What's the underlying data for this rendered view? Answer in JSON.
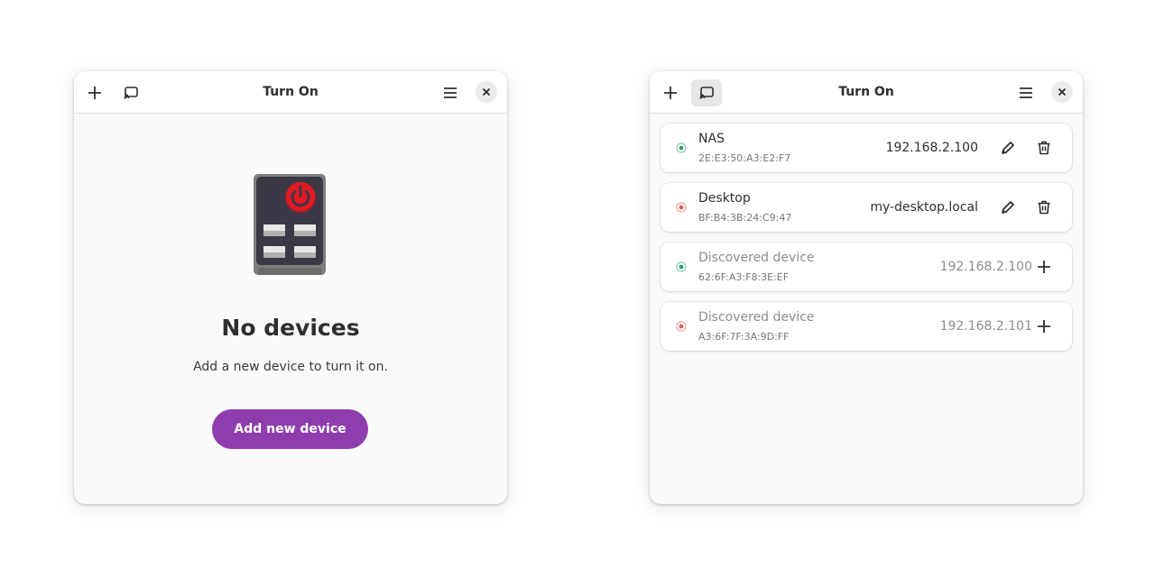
{
  "left_window": {
    "title": "Turn On",
    "empty_state": {
      "title": "No devices",
      "description": "Add a new device to turn it on.",
      "button_label": "Add new device"
    }
  },
  "right_window": {
    "title": "Turn On",
    "devices": [
      {
        "name": "NAS",
        "mac": "2E:E3:50:A3:E2:F7",
        "host": "192.168.2.100",
        "status": "online"
      },
      {
        "name": "Desktop",
        "mac": "BF:B4:3B:24:C9:47",
        "host": "my-desktop.local",
        "status": "offline"
      }
    ],
    "discovered": [
      {
        "name": "Discovered device",
        "mac": "62:6F:A3:F8:3E:EF",
        "host": "192.168.2.100",
        "status": "online"
      },
      {
        "name": "Discovered device",
        "mac": "A3:6F:7F:3A:9D:FF",
        "host": "192.168.2.101",
        "status": "offline"
      }
    ]
  },
  "icons": {
    "add": "plus-icon",
    "discover": "cast-icon",
    "menu": "hamburger-icon",
    "close": "close-icon",
    "edit": "pencil-icon",
    "delete": "trash-icon",
    "status": "target-dot-icon"
  },
  "colors": {
    "accent": "#8e3dae",
    "online": "#33a06a",
    "offline": "#e05a5a"
  }
}
